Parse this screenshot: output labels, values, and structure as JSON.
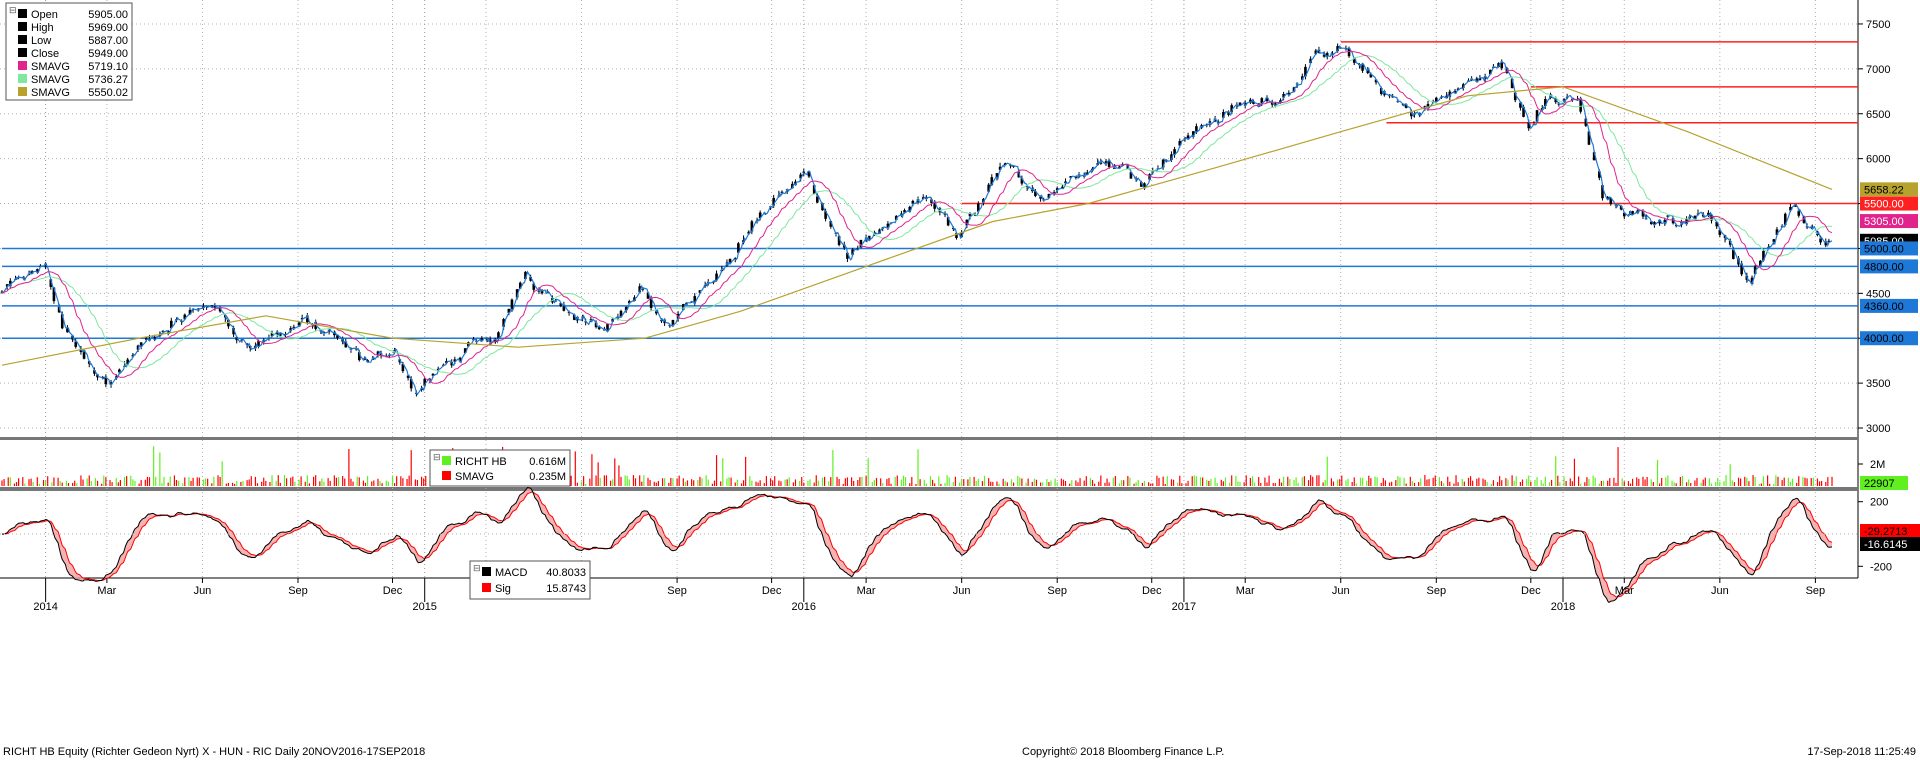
{
  "chart_data": {
    "type": "candlestick",
    "price_panel": {
      "ylim": [
        2900,
        7700
      ],
      "ticks": [
        3000,
        3500,
        4000,
        4500,
        5000,
        5500,
        6000,
        6500,
        7000,
        7500
      ],
      "legend": [
        {
          "label": "Open",
          "value": "5905.00",
          "color": "#000000"
        },
        {
          "label": "High",
          "value": "5969.00",
          "color": "#000000"
        },
        {
          "label": "Low",
          "value": "5887.00",
          "color": "#000000"
        },
        {
          "label": "Close",
          "value": "5949.00",
          "color": "#000000"
        },
        {
          "label": "SMAVG",
          "value": "5719.10",
          "color": "#e0248c"
        },
        {
          "label": "SMAVG",
          "value": "5736.27",
          "color": "#7fe7a0"
        },
        {
          "label": "SMAVG",
          "value": "5550.02",
          "color": "#b8a22e"
        }
      ],
      "horizontal_lines": [
        {
          "y": 7300,
          "color": "#ff2020",
          "x_start": "2017-06-01"
        },
        {
          "y": 6800,
          "color": "#ff2020",
          "x_start": "2017-12-01"
        },
        {
          "y": 6400,
          "color": "#ff2020",
          "x_start": "2017-07-15"
        },
        {
          "y": 5500,
          "color": "#ff2020",
          "x_start": "2016-06-01"
        },
        {
          "y": 5000,
          "color": "#1e78d8",
          "x_start": "2013-11-20"
        },
        {
          "y": 4800,
          "color": "#1e78d8",
          "x_start": "2013-11-20"
        },
        {
          "y": 4360,
          "color": "#1e78d8",
          "x_start": "2013-11-20"
        },
        {
          "y": 4000,
          "color": "#1e78d8",
          "x_start": "2013-11-20"
        }
      ],
      "tags": [
        {
          "value": 5658.22,
          "text": "5658.22",
          "bg": "#b8a22e",
          "fg": "#000000"
        },
        {
          "value": 5500,
          "text": "5500.00",
          "bg": "#ff2020",
          "fg": "#ffffff"
        },
        {
          "value": 5305,
          "text": "5305.00",
          "bg": "#e0248c",
          "fg": "#ffffff"
        },
        {
          "value": 5085,
          "text": "5085.00",
          "bg": "#000000",
          "fg": "#ffffff"
        },
        {
          "value": 5000,
          "text": "5000.00",
          "bg": "#1e78d8",
          "fg": "#000000"
        },
        {
          "value": 4800,
          "text": "4800.00",
          "bg": "#1e78d8",
          "fg": "#000000"
        },
        {
          "value": 4360,
          "text": "4360.00",
          "bg": "#1e78d8",
          "fg": "#000000"
        },
        {
          "value": 4000,
          "text": "4000.00",
          "bg": "#1e78d8",
          "fg": "#000000"
        }
      ],
      "close_series": [
        {
          "x": "2013-11-20",
          "y": 4500
        },
        {
          "x": "2014-01-03",
          "y": 4800
        },
        {
          "x": "2014-01-20",
          "y": 4100
        },
        {
          "x": "2014-03-05",
          "y": 3500
        },
        {
          "x": "2014-04-05",
          "y": 3900
        },
        {
          "x": "2014-06-10",
          "y": 4400
        },
        {
          "x": "2014-07-20",
          "y": 3900
        },
        {
          "x": "2014-09-10",
          "y": 4200
        },
        {
          "x": "2014-11-10",
          "y": 3700
        },
        {
          "x": "2014-12-05",
          "y": 3900
        },
        {
          "x": "2014-12-25",
          "y": 3400
        },
        {
          "x": "2015-02-10",
          "y": 3850
        },
        {
          "x": "2015-03-15",
          "y": 4000
        },
        {
          "x": "2015-04-10",
          "y": 4750
        },
        {
          "x": "2015-05-15",
          "y": 4400
        },
        {
          "x": "2015-06-25",
          "y": 4100
        },
        {
          "x": "2015-08-01",
          "y": 4500
        },
        {
          "x": "2015-08-25",
          "y": 4150
        },
        {
          "x": "2015-09-25",
          "y": 4500
        },
        {
          "x": "2015-11-05",
          "y": 5100
        },
        {
          "x": "2015-12-01",
          "y": 5500
        },
        {
          "x": "2016-01-05",
          "y": 5800
        },
        {
          "x": "2016-02-15",
          "y": 4900
        },
        {
          "x": "2016-04-05",
          "y": 5300
        },
        {
          "x": "2016-05-01",
          "y": 5600
        },
        {
          "x": "2016-06-01",
          "y": 5100
        },
        {
          "x": "2016-07-10",
          "y": 5900
        },
        {
          "x": "2016-08-20",
          "y": 5600
        },
        {
          "x": "2016-10-15",
          "y": 6000
        },
        {
          "x": "2016-11-25",
          "y": 5800
        },
        {
          "x": "2017-01-10",
          "y": 6300
        },
        {
          "x": "2017-02-20",
          "y": 6550
        },
        {
          "x": "2017-04-05",
          "y": 6700
        },
        {
          "x": "2017-05-10",
          "y": 7100
        },
        {
          "x": "2017-06-05",
          "y": 7200
        },
        {
          "x": "2017-07-10",
          "y": 6800
        },
        {
          "x": "2017-08-10",
          "y": 6500
        },
        {
          "x": "2017-09-15",
          "y": 6700
        },
        {
          "x": "2017-11-05",
          "y": 7050
        },
        {
          "x": "2017-12-01",
          "y": 6400
        },
        {
          "x": "2017-12-20",
          "y": 6700
        },
        {
          "x": "2018-01-20",
          "y": 6600
        },
        {
          "x": "2018-02-10",
          "y": 5600
        },
        {
          "x": "2018-03-01",
          "y": 5400
        },
        {
          "x": "2018-04-01",
          "y": 5300
        },
        {
          "x": "2018-05-25",
          "y": 5400
        },
        {
          "x": "2018-06-15",
          "y": 5000
        },
        {
          "x": "2018-07-01",
          "y": 4600
        },
        {
          "x": "2018-07-20",
          "y": 5000
        },
        {
          "x": "2018-08-15",
          "y": 5500
        },
        {
          "x": "2018-09-03",
          "y": 5200
        },
        {
          "x": "2018-09-17",
          "y": 5085
        }
      ],
      "sma_slow": [
        {
          "x": "2013-11-20",
          "y": 3700
        },
        {
          "x": "2014-04-01",
          "y": 4000
        },
        {
          "x": "2014-08-01",
          "y": 4250
        },
        {
          "x": "2014-12-01",
          "y": 4000
        },
        {
          "x": "2015-04-01",
          "y": 3900
        },
        {
          "x": "2015-08-01",
          "y": 4000
        },
        {
          "x": "2015-11-01",
          "y": 4300
        },
        {
          "x": "2016-03-01",
          "y": 4800
        },
        {
          "x": "2016-07-01",
          "y": 5300
        },
        {
          "x": "2016-10-01",
          "y": 5500
        },
        {
          "x": "2017-02-01",
          "y": 5900
        },
        {
          "x": "2017-06-01",
          "y": 6300
        },
        {
          "x": "2017-10-01",
          "y": 6700
        },
        {
          "x": "2018-01-01",
          "y": 6800
        },
        {
          "x": "2018-05-01",
          "y": 6300
        },
        {
          "x": "2018-09-17",
          "y": 5658
        }
      ]
    },
    "volume_panel": {
      "ticks": [
        {
          "value": 2,
          "label": "2M"
        }
      ],
      "legend": [
        {
          "label": "RICHT HB",
          "value": "0.616M",
          "color": "#60f020"
        },
        {
          "label": "SMAVG",
          "value": "0.235M",
          "color": "#ff0000"
        }
      ],
      "tag": {
        "text": "22907",
        "bg": "#60f020",
        "fg": "#000000"
      }
    },
    "macd_panel": {
      "ylim": [
        -260,
        260
      ],
      "ticks": [
        {
          "value": 200,
          "label": "200"
        },
        {
          "value": -200,
          "label": "-200"
        }
      ],
      "legend": [
        {
          "label": "MACD",
          "value": "40.8033",
          "color": "#000000"
        },
        {
          "label": "Sig",
          "value": "15.8743",
          "color": "#ff0000"
        }
      ],
      "tags": [
        {
          "text": "-29.2713",
          "bg": "#ff0000",
          "fg": "#000000"
        },
        {
          "text": "-16.6145",
          "bg": "#000000",
          "fg": "#ffffff"
        }
      ]
    },
    "x_axis": {
      "months": [
        {
          "date": "2014-03-01",
          "label": "Mar"
        },
        {
          "date": "2014-06-01",
          "label": "Jun"
        },
        {
          "date": "2014-09-01",
          "label": "Sep"
        },
        {
          "date": "2014-12-01",
          "label": "Dec"
        },
        {
          "date": "2015-03-01",
          "label": "Mar"
        },
        {
          "date": "2015-06-01",
          "label": "Jun"
        },
        {
          "date": "2015-09-01",
          "label": "Sep"
        },
        {
          "date": "2015-12-01",
          "label": "Dec"
        },
        {
          "date": "2016-03-01",
          "label": "Mar"
        },
        {
          "date": "2016-06-01",
          "label": "Jun"
        },
        {
          "date": "2016-09-01",
          "label": "Sep"
        },
        {
          "date": "2016-12-01",
          "label": "Dec"
        },
        {
          "date": "2017-03-01",
          "label": "Mar"
        },
        {
          "date": "2017-06-01",
          "label": "Jun"
        },
        {
          "date": "2017-09-01",
          "label": "Sep"
        },
        {
          "date": "2017-12-01",
          "label": "Dec"
        },
        {
          "date": "2018-03-01",
          "label": "Mar"
        },
        {
          "date": "2018-06-01",
          "label": "Jun"
        },
        {
          "date": "2018-09-01",
          "label": "Sep"
        }
      ],
      "years": [
        {
          "date": "2014-01-01",
          "label": "2014"
        },
        {
          "date": "2015-01-01",
          "label": "2015"
        },
        {
          "date": "2016-01-01",
          "label": "2016"
        },
        {
          "date": "2017-01-01",
          "label": "2017"
        },
        {
          "date": "2018-01-01",
          "label": "2018"
        }
      ]
    }
  },
  "footer": {
    "left": "RICHT HB Equity (Richter Gedeon Nyrt) X - HUN - RIC  Daily 20NOV2016-17SEP2018",
    "center": "Copyright© 2018 Bloomberg Finance L.P.",
    "right": "17-Sep-2018 11:25:49"
  },
  "colors": {
    "candle": "#000000",
    "close_line": "#1e78d8",
    "sma_fast": "#e0248c",
    "sma_mid": "#7fe7a0",
    "sma_slow": "#b8a22e",
    "panel_sep": "#888888",
    "grid": "#b0b0b0"
  }
}
